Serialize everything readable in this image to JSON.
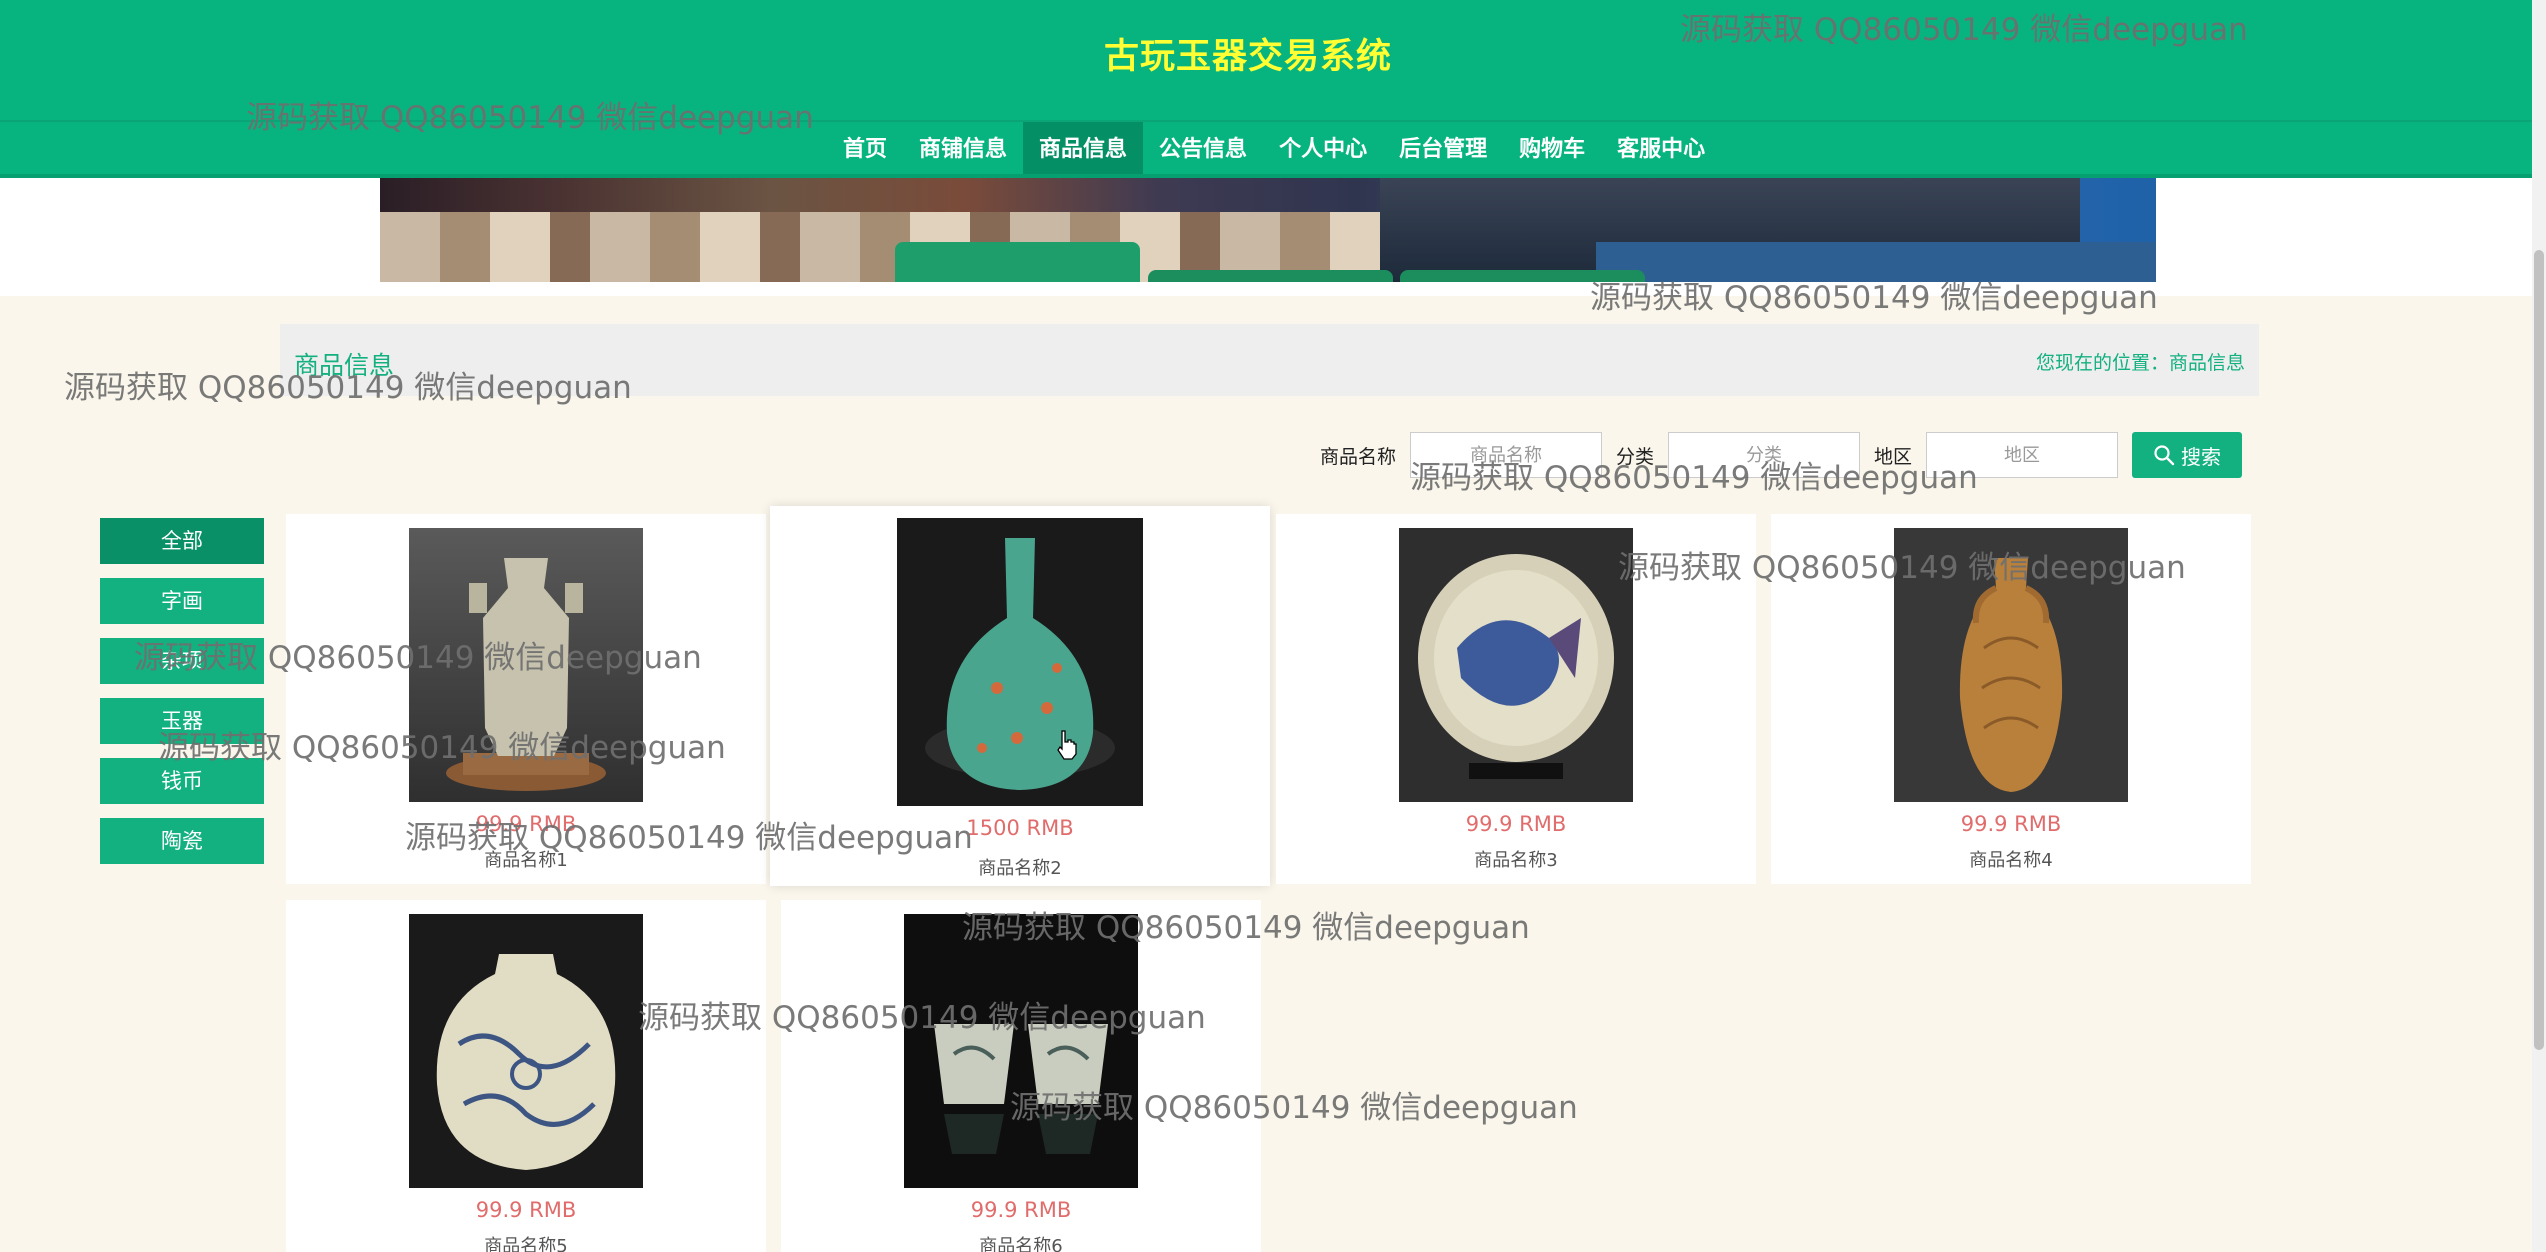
{
  "header": {
    "title": "古玩玉器交易系统",
    "nav": [
      {
        "label": "首页",
        "active": false
      },
      {
        "label": "商铺信息",
        "active": false
      },
      {
        "label": "商品信息",
        "active": true
      },
      {
        "label": "公告信息",
        "active": false
      },
      {
        "label": "个人中心",
        "active": false
      },
      {
        "label": "后台管理",
        "active": false
      },
      {
        "label": "购物车",
        "active": false
      },
      {
        "label": "客服中心",
        "active": false
      }
    ]
  },
  "section": {
    "title": "商品信息",
    "breadcrumb": "您现在的位置：商品信息"
  },
  "search": {
    "name_label": "商品名称",
    "name_placeholder": "商品名称",
    "category_label": "分类",
    "category_placeholder": "分类",
    "region_label": "地区",
    "region_placeholder": "地区",
    "button_label": "搜索"
  },
  "categories": [
    {
      "label": "全部",
      "active": true
    },
    {
      "label": "字画",
      "active": false
    },
    {
      "label": "杂项",
      "active": false
    },
    {
      "label": "玉器",
      "active": false
    },
    {
      "label": "钱币",
      "active": false
    },
    {
      "label": "陶瓷",
      "active": false
    }
  ],
  "products": [
    {
      "name": "商品名称1",
      "price": "99.9 RMB",
      "image": "celadon-hexagonal-vase"
    },
    {
      "name": "商品名称2",
      "price": "1500 RMB",
      "image": "turquoise-bottle-vase"
    },
    {
      "name": "商品名称3",
      "price": "99.9 RMB",
      "image": "fish-plate"
    },
    {
      "name": "商品名称4",
      "price": "99.9 RMB",
      "image": "amber-glazed-vase"
    },
    {
      "name": "商品名称5",
      "price": "99.9 RMB",
      "image": "blue-white-jar"
    },
    {
      "name": "商品名称6",
      "price": "99.9 RMB",
      "image": "blue-white-cups"
    }
  ],
  "watermark": "源码获取 QQ86050149 微信deepguan",
  "colors": {
    "primary": "#07b47f",
    "title": "#ffff33",
    "price": "#e06c6c",
    "background": "#faf6ec"
  }
}
